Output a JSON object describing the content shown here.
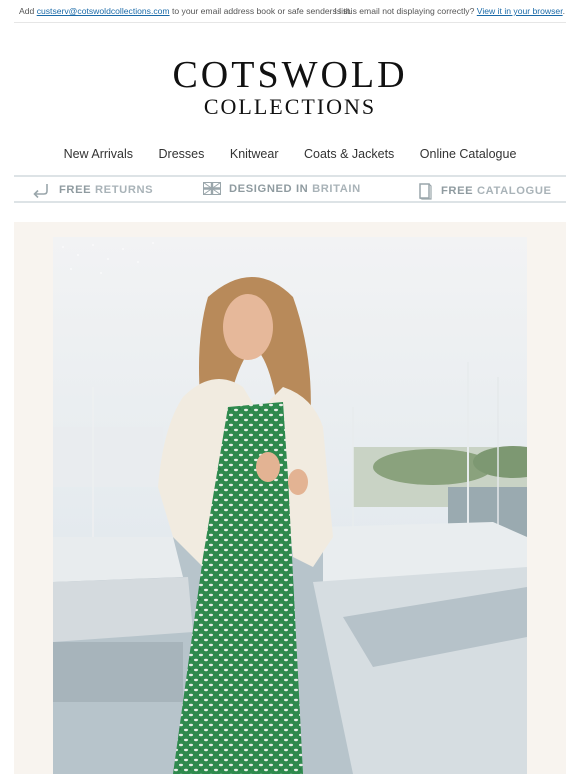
{
  "preheader": {
    "add_prefix": "Add",
    "email_link": "custserv@cotswoldcollections.com",
    "add_suffix": "to your email address book or safe senders list.",
    "display_question": "Is this email not displaying correctly?",
    "browser_link": "View it in your browser",
    "browser_suffix": "."
  },
  "logo": {
    "line1": "COTSWOLD",
    "line2": "COLLECTIONS"
  },
  "nav": [
    "New Arrivals",
    "Dresses",
    "Knitwear",
    "Coats & Jackets",
    "Online Catalogue"
  ],
  "usp": [
    {
      "icon": "return-arrow-icon",
      "bold": "FREE",
      "light": "RETURNS"
    },
    {
      "icon": "union-flag-icon",
      "bold": "DESIGNED IN",
      "light": "BRITAIN"
    },
    {
      "icon": "catalogue-book-icon",
      "bold": "FREE",
      "light": "CATALOGUE"
    }
  ],
  "hero": {
    "description_icon": "hero-photo",
    "colors": {
      "background_panel": "#f8f4ef",
      "dress": "#2f8a4e",
      "jacket": "#f1ebe0",
      "sky": "#dde6ec"
    }
  }
}
